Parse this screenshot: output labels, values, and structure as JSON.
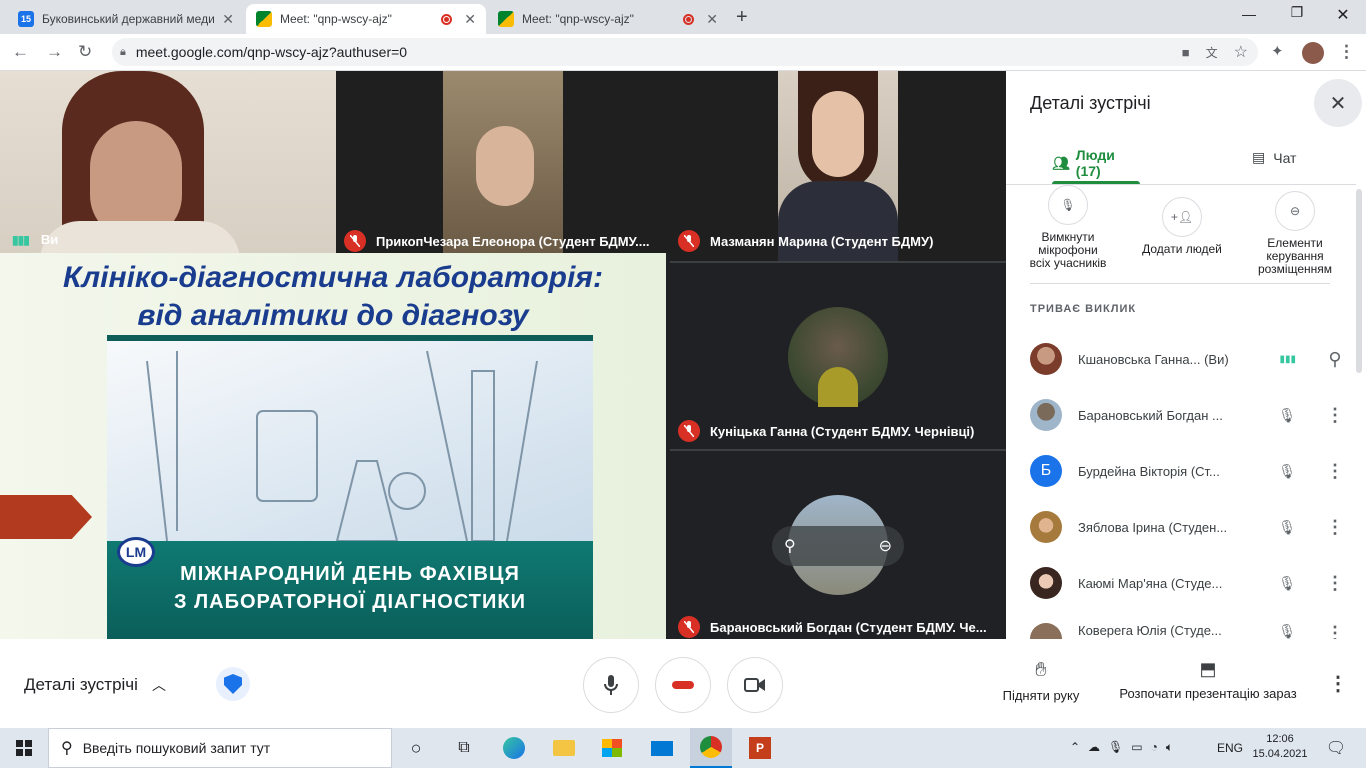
{
  "browser": {
    "tabs": [
      {
        "title": "Буковинський державний меди",
        "active": false
      },
      {
        "title": "Meet: \"qnp-wscy-ajz\"",
        "active": true
      },
      {
        "title": "Meet: \"qnp-wscy-ajz\"",
        "active": false
      }
    ],
    "url": "meet.google.com/qnp-wscy-ajz?authuser=0",
    "favicon_calendar_text": "15"
  },
  "tiles": {
    "self_label": "Ви",
    "p1_label": "ПрикопЧезара Елеонора (Студент БДМУ....",
    "p2_label": "Мазманян Марина (Студент БДМУ)",
    "p3_label": "Куніцька Ганна (Студент БДМУ. Чернівці)",
    "p4_label": "Барановський Богдан (Студент БДМУ. Че..."
  },
  "slide": {
    "title_line1": "Клініко-діагностична лабораторія:",
    "title_line2": "від аналітики до діагнозу",
    "logo": "LM",
    "banner_line1": "МІЖНАРОДНИЙ ДЕНЬ ФАХІВЦЯ",
    "banner_line2": "З ЛАБОРАТОРНОЇ ДІАГНОСТИКИ"
  },
  "panel": {
    "title": "Деталі зустрічі",
    "tab_people": "Люди (17)",
    "tab_chat": "Чат",
    "mute_all": "Вимкнути мікрофони всіх учасників",
    "add_people": "Додати людей",
    "layout_controls": "Елементи керування розміщенням",
    "section_label": "ТРИВАЄ ВИКЛИК",
    "people": [
      {
        "name": "Кшановська Ганна...",
        "suffix": "(Ви)"
      },
      {
        "name": "Барановський Богдан ..."
      },
      {
        "name": "Бурдейна Вікторія (Ст...",
        "initial": "Б"
      },
      {
        "name": "Зяблова Ірина (Студен..."
      },
      {
        "name": "Каюмі Мар'яна (Студе..."
      },
      {
        "name": "Коверега Юлія (Студе..."
      }
    ]
  },
  "bottom": {
    "details_label": "Деталі зустрічі",
    "raise_hand": "Підняти руку",
    "present": "Розпочати презентацію зараз"
  },
  "taskbar": {
    "search_placeholder": "Введіть пошуковий запит тут",
    "lang": "ENG",
    "time": "12:06",
    "date": "15.04.2021"
  },
  "colors": {
    "accent_green": "#1e8e3e",
    "mic_off_red": "#d93025",
    "meet_dark": "#202124",
    "slide_title": "#1a3c8e",
    "banner_teal": "#0f6f6b"
  }
}
